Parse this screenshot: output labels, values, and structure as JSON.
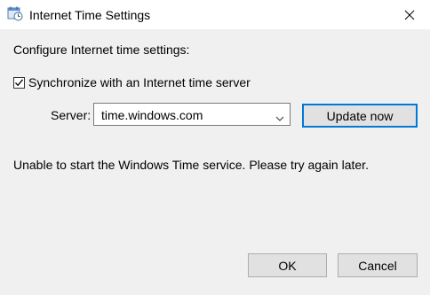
{
  "window": {
    "title": "Internet Time Settings",
    "icon": "clock-calendar-icon"
  },
  "content": {
    "heading": "Configure Internet time settings:",
    "sync_checkbox": {
      "label": "Synchronize with an Internet time server",
      "checked": true
    },
    "server": {
      "label": "Server:",
      "value": "time.windows.com"
    },
    "update_button": "Update now",
    "status_message": "Unable to start the Windows Time service. Please try again later."
  },
  "footer": {
    "ok_label": "OK",
    "cancel_label": "Cancel"
  },
  "colors": {
    "accent": "#0078d7",
    "dialog_bg": "#f0f0f0",
    "button_bg": "#e1e1e1"
  }
}
